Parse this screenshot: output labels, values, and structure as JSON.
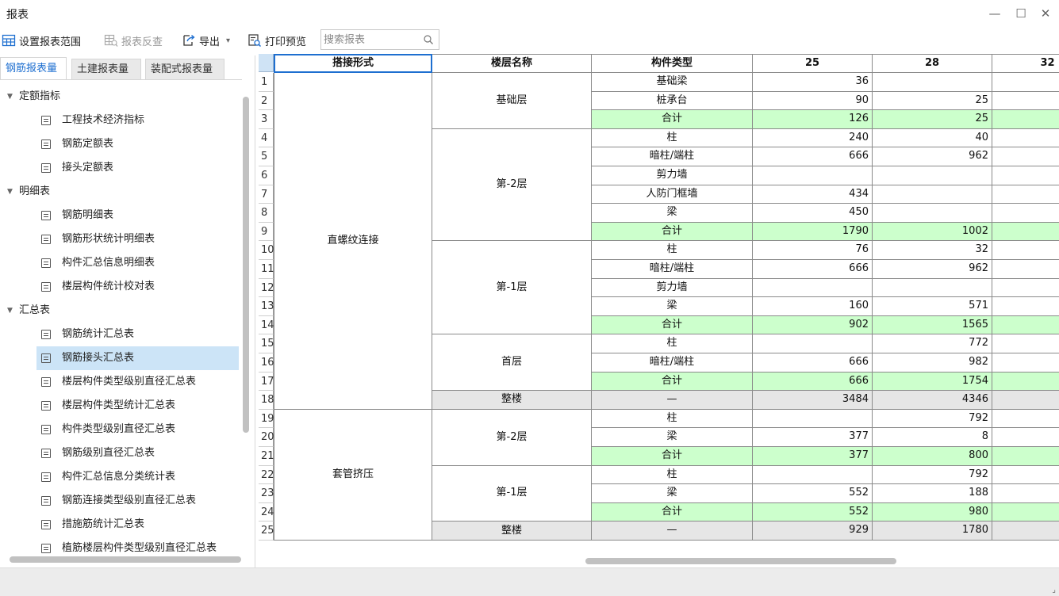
{
  "window": {
    "title": "报表",
    "minimize": "—",
    "maximize": "☐",
    "close": "✕"
  },
  "toolbar": {
    "set_range": "设置报表范围",
    "reverse_check": "报表反查",
    "export": "导出",
    "export_arrow": "▾",
    "print_preview": "打印预览",
    "search_placeholder": "搜索报表"
  },
  "tabs": [
    {
      "label": "钢筋报表量",
      "active": true
    },
    {
      "label": "土建报表量",
      "active": false
    },
    {
      "label": "装配式报表量",
      "active": false
    }
  ],
  "tree": [
    {
      "type": "group",
      "label": "定额指标"
    },
    {
      "type": "leaf",
      "label": "工程技术经济指标"
    },
    {
      "type": "leaf",
      "label": "钢筋定额表"
    },
    {
      "type": "leaf",
      "label": "接头定额表"
    },
    {
      "type": "group",
      "label": "明细表"
    },
    {
      "type": "leaf",
      "label": "钢筋明细表"
    },
    {
      "type": "leaf",
      "label": "钢筋形状统计明细表"
    },
    {
      "type": "leaf",
      "label": "构件汇总信息明细表"
    },
    {
      "type": "leaf",
      "label": "楼层构件统计校对表"
    },
    {
      "type": "group",
      "label": "汇总表"
    },
    {
      "type": "leaf",
      "label": "钢筋统计汇总表"
    },
    {
      "type": "leaf",
      "label": "钢筋接头汇总表",
      "selected": true
    },
    {
      "type": "leaf",
      "label": "楼层构件类型级别直径汇总表"
    },
    {
      "type": "leaf",
      "label": "楼层构件类型统计汇总表"
    },
    {
      "type": "leaf",
      "label": "构件类型级别直径汇总表"
    },
    {
      "type": "leaf",
      "label": "钢筋级别直径汇总表"
    },
    {
      "type": "leaf",
      "label": "构件汇总信息分类统计表"
    },
    {
      "type": "leaf",
      "label": "钢筋连接类型级别直径汇总表"
    },
    {
      "type": "leaf",
      "label": "措施筋统计汇总表"
    },
    {
      "type": "leaf",
      "label": "植筋楼层构件类型级别直径汇总表"
    }
  ],
  "table": {
    "headers": [
      "搭接形式",
      "楼层名称",
      "构件类型",
      "25",
      "28",
      "32"
    ],
    "groups": [
      {
        "label": "直螺纹连接",
        "start": 1,
        "end": 18
      },
      {
        "label": "套管挤压",
        "start": 19,
        "end": 25
      }
    ],
    "floors": [
      {
        "label": "基础层",
        "start": 1,
        "end": 3
      },
      {
        "label": "第-2层",
        "start": 4,
        "end": 9
      },
      {
        "label": "第-1层",
        "start": 10,
        "end": 14
      },
      {
        "label": "首层",
        "start": 15,
        "end": 17
      },
      {
        "label": "整楼",
        "start": 18,
        "end": 18,
        "total": true
      },
      {
        "label": "第-2层",
        "start": 19,
        "end": 21
      },
      {
        "label": "第-1层",
        "start": 22,
        "end": 24
      },
      {
        "label": "整楼",
        "start": 25,
        "end": 25,
        "total": true
      }
    ],
    "rows": [
      {
        "n": "1",
        "type": "基础梁",
        "v25": "36",
        "v28": "",
        "v32": "",
        "kind": "normal"
      },
      {
        "n": "2",
        "type": "桩承台",
        "v25": "90",
        "v28": "25",
        "v32": "",
        "kind": "normal"
      },
      {
        "n": "3",
        "type": "合计",
        "v25": "126",
        "v28": "25",
        "v32": "",
        "kind": "subtotal"
      },
      {
        "n": "4",
        "type": "柱",
        "v25": "240",
        "v28": "40",
        "v32": "",
        "kind": "normal"
      },
      {
        "n": "5",
        "type": "暗柱/端柱",
        "v25": "666",
        "v28": "962",
        "v32": "",
        "kind": "normal"
      },
      {
        "n": "6",
        "type": "剪力墙",
        "v25": "",
        "v28": "",
        "v32": "",
        "kind": "normal"
      },
      {
        "n": "7",
        "type": "人防门框墙",
        "v25": "434",
        "v28": "",
        "v32": "",
        "kind": "normal"
      },
      {
        "n": "8",
        "type": "梁",
        "v25": "450",
        "v28": "",
        "v32": "",
        "kind": "normal"
      },
      {
        "n": "9",
        "type": "合计",
        "v25": "1790",
        "v28": "1002",
        "v32": "",
        "kind": "subtotal"
      },
      {
        "n": "10",
        "type": "柱",
        "v25": "76",
        "v28": "32",
        "v32": "",
        "kind": "normal"
      },
      {
        "n": "11",
        "type": "暗柱/端柱",
        "v25": "666",
        "v28": "962",
        "v32": "",
        "kind": "normal"
      },
      {
        "n": "12",
        "type": "剪力墙",
        "v25": "",
        "v28": "",
        "v32": "",
        "kind": "normal"
      },
      {
        "n": "13",
        "type": "梁",
        "v25": "160",
        "v28": "571",
        "v32": "",
        "kind": "normal"
      },
      {
        "n": "14",
        "type": "合计",
        "v25": "902",
        "v28": "1565",
        "v32": "",
        "kind": "subtotal"
      },
      {
        "n": "15",
        "type": "柱",
        "v25": "",
        "v28": "772",
        "v32": "",
        "kind": "normal"
      },
      {
        "n": "16",
        "type": "暗柱/端柱",
        "v25": "666",
        "v28": "982",
        "v32": "",
        "kind": "normal"
      },
      {
        "n": "17",
        "type": "合计",
        "v25": "666",
        "v28": "1754",
        "v32": "",
        "kind": "subtotal"
      },
      {
        "n": "18",
        "type": "—",
        "v25": "3484",
        "v28": "4346",
        "v32": "",
        "kind": "total"
      },
      {
        "n": "19",
        "type": "柱",
        "v25": "",
        "v28": "792",
        "v32": "",
        "kind": "normal"
      },
      {
        "n": "20",
        "type": "梁",
        "v25": "377",
        "v28": "8",
        "v32": "",
        "kind": "normal"
      },
      {
        "n": "21",
        "type": "合计",
        "v25": "377",
        "v28": "800",
        "v32": "",
        "kind": "subtotal"
      },
      {
        "n": "22",
        "type": "柱",
        "v25": "",
        "v28": "792",
        "v32": "",
        "kind": "normal"
      },
      {
        "n": "23",
        "type": "梁",
        "v25": "552",
        "v28": "188",
        "v32": "",
        "kind": "normal"
      },
      {
        "n": "24",
        "type": "合计",
        "v25": "552",
        "v28": "980",
        "v32": "",
        "kind": "subtotal"
      },
      {
        "n": "25",
        "type": "—",
        "v25": "929",
        "v28": "1780",
        "v32": "",
        "kind": "total"
      }
    ]
  },
  "colors": {
    "subtotal_bg": "#ccffcc",
    "total_bg": "#e6e6e6",
    "selected_tree_bg": "#cce4f7",
    "active_tab": "#1e6fd0"
  }
}
